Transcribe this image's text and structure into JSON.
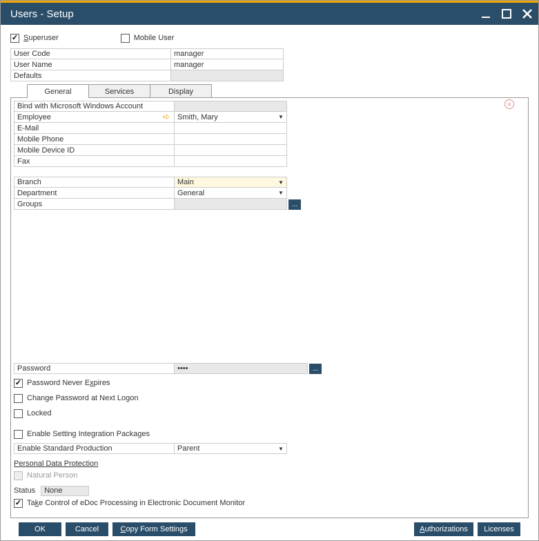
{
  "window": {
    "title": "Users - Setup"
  },
  "topChecks": {
    "superuser": {
      "label": "Superuser",
      "checked": true
    },
    "mobileUser": {
      "label": "Mobile User",
      "checked": false
    }
  },
  "header": {
    "userCodeLabel": "User Code",
    "userCodeValue": "manager",
    "userNameLabel": "User Name",
    "userNameValue": "manager",
    "defaultsLabel": "Defaults",
    "defaultsValue": ""
  },
  "tabs": {
    "general": "General",
    "services": "Services",
    "display": "Display"
  },
  "general": {
    "bindLabel": "Bind with Microsoft Windows Account",
    "bindValue": "",
    "employeeLabel": "Employee",
    "employeeValue": "Smith, Mary",
    "emailLabel": "E-Mail",
    "emailValue": "",
    "mobilePhoneLabel": "Mobile Phone",
    "mobilePhoneValue": "",
    "mobileDeviceLabel": "Mobile Device ID",
    "mobileDeviceValue": "",
    "faxLabel": "Fax",
    "faxValue": "",
    "branchLabel": "Branch",
    "branchValue": "Main",
    "departmentLabel": "Department",
    "departmentValue": "General",
    "groupsLabel": "Groups",
    "groupsValue": "",
    "passwordLabel": "Password",
    "passwordValue": "••••",
    "pwdNeverExpires": {
      "label": "Password Never Expires",
      "checked": true
    },
    "changePwdNext": {
      "label": "Change Password at Next Logon",
      "checked": false
    },
    "locked": {
      "label": "Locked",
      "checked": false
    },
    "enableIntegration": {
      "label": "Enable Setting Integration Packages",
      "checked": false
    },
    "stdProdLabel": "Enable Standard Production",
    "stdProdValue": "Parent",
    "pdpHeading": "Personal Data Protection",
    "naturalPerson": {
      "label": "Natural Person",
      "checked": false
    },
    "statusLabel": "Status",
    "statusValue": "None",
    "takeControl": {
      "label": "Take Control of eDoc Processing in Electronic Document Monitor",
      "checked": true
    }
  },
  "footer": {
    "ok": "OK",
    "cancel": "Cancel",
    "copyFormSettings": "Copy Form Settings",
    "authorizations": "Authorizations",
    "licenses": "Licenses"
  }
}
